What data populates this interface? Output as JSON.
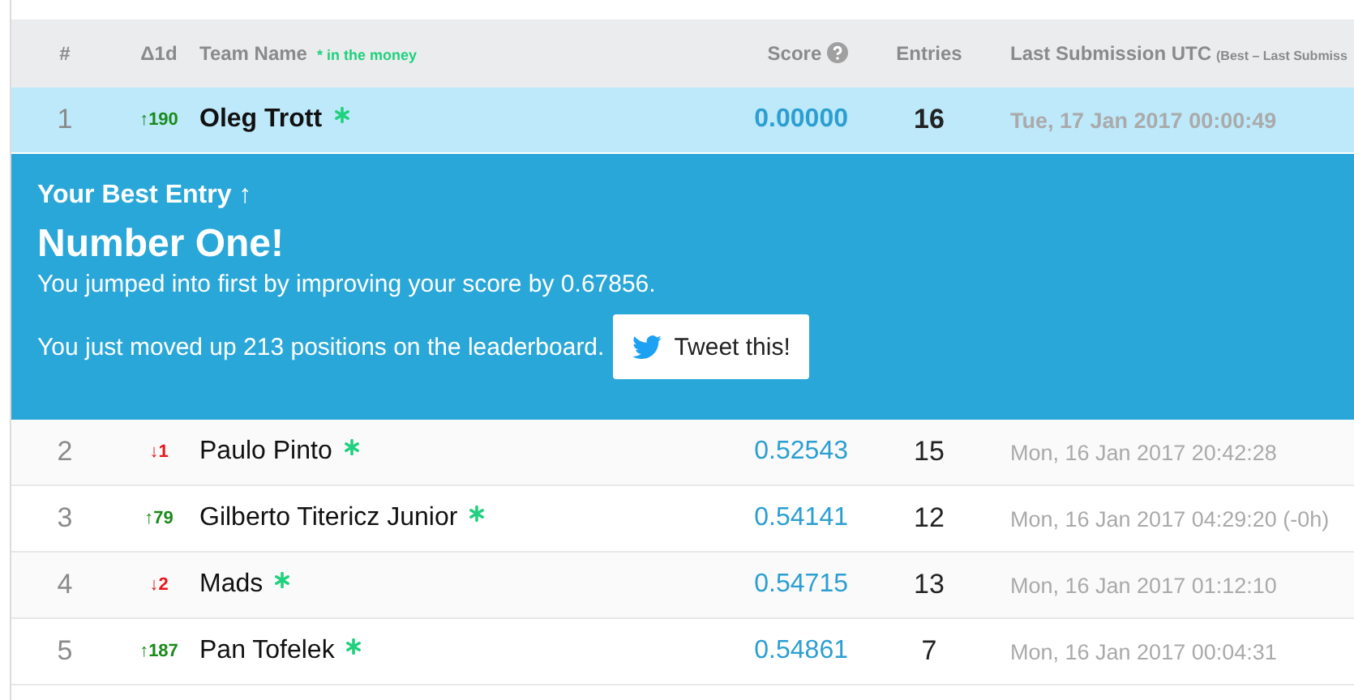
{
  "header": {
    "rank": "#",
    "delta": "Δ1d",
    "team": "Team Name",
    "money_note": "* in the money",
    "score": "Score",
    "entries": "Entries",
    "last": "Last Submission UTC",
    "last_note": "(Best – Last Submiss"
  },
  "rows": [
    {
      "rank": "1",
      "delta": "↑190",
      "color": "#1a8a1a",
      "team": "Oleg Trott",
      "in_the_money": true,
      "score": "0.00000",
      "entries": "16",
      "last": "Tue, 17 Jan 2017 00:00:49",
      "selected": true,
      "banner": {
        "kicker": "Your Best Entry ↑",
        "title": "Number One!",
        "line_1": "You jumped into first by improving your score by 0.67856.",
        "line_2": "You just moved up 213 positions on the leaderboard.",
        "button": "Tweet this!"
      }
    },
    {
      "rank": "2",
      "delta": "↓1",
      "color": "#e8161b",
      "team": "Paulo Pinto",
      "in_the_money": true,
      "score": "0.52543",
      "entries": "15",
      "last": "Mon, 16 Jan 2017 20:42:28",
      "selected": false
    },
    {
      "rank": "3",
      "delta": "↑79",
      "color": "#1a8a1a",
      "team": "Gilberto Titericz Junior",
      "in_the_money": true,
      "score": "0.54141",
      "entries": "12",
      "last": "Mon, 16 Jan 2017 04:29:20 (-0h)",
      "selected": false
    },
    {
      "rank": "4",
      "delta": "↓2",
      "color": "#e8161b",
      "team": "Mads",
      "in_the_money": true,
      "score": "0.54715",
      "entries": "13",
      "last": "Mon, 16 Jan 2017 01:12:10",
      "selected": false
    },
    {
      "rank": "5",
      "delta": "↑187",
      "color": "#1a8a1a",
      "team": "Pan Tofelek",
      "in_the_money": true,
      "score": "0.54861",
      "entries": "7",
      "last": "Mon, 16 Jan 2017 00:04:31",
      "selected": false
    }
  ]
}
